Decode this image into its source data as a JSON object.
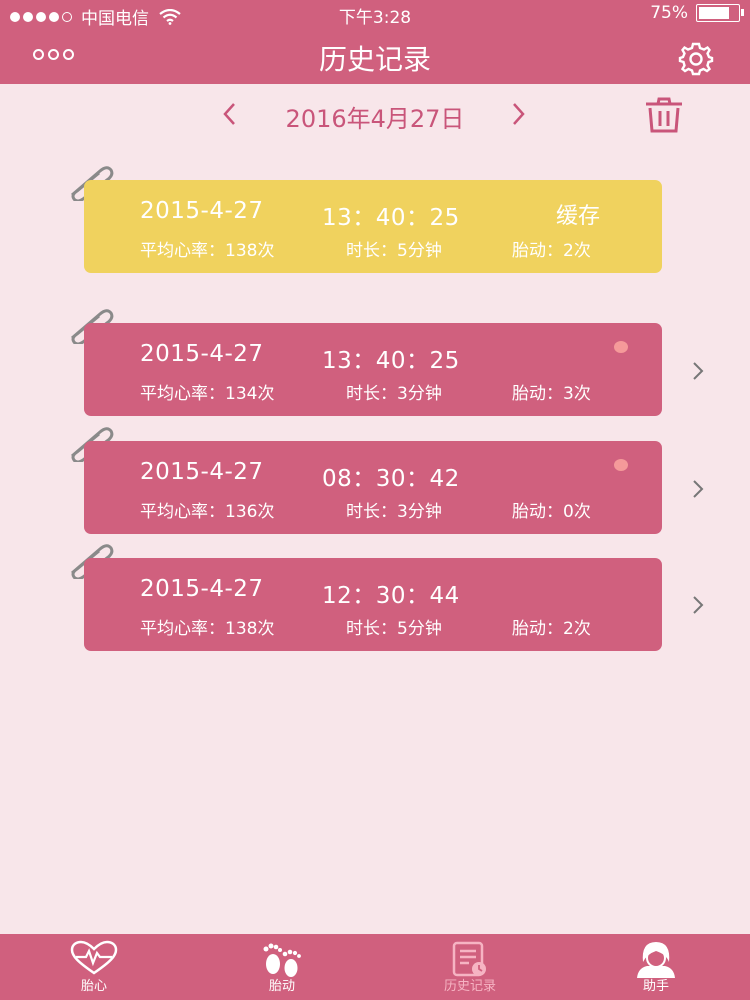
{
  "status_bar": {
    "carrier": "中国电信",
    "time": "下午3:28",
    "battery": "75%",
    "battery_level": 0.75
  },
  "header": {
    "title": "历史记录"
  },
  "date_nav": {
    "date": "2016年4月27日"
  },
  "records": [
    {
      "date": "2015-4-27",
      "time": "13：40：25",
      "badge": "缓存",
      "heart_rate": "平均心率：138次",
      "duration": "时长：5分钟",
      "movement": "胎动：2次",
      "cached": true,
      "unread": false
    },
    {
      "date": "2015-4-27",
      "time": "13：40：25",
      "badge": "",
      "heart_rate": "平均心率：134次",
      "duration": "时长：3分钟",
      "movement": "胎动：3次",
      "cached": false,
      "unread": true
    },
    {
      "date": "2015-4-27",
      "time": "08：30：42",
      "badge": "",
      "heart_rate": "平均心率：136次",
      "duration": "时长：3分钟",
      "movement": "胎动：0次",
      "cached": false,
      "unread": true
    },
    {
      "date": "2015-4-27",
      "time": "12：30：44",
      "badge": "",
      "heart_rate": "平均心率：138次",
      "duration": "时长：5分钟",
      "movement": "胎动：2次",
      "cached": false,
      "unread": false
    }
  ],
  "tabs": [
    {
      "label": "胎心",
      "icon": "heart-pulse-icon"
    },
    {
      "label": "胎动",
      "icon": "footprints-icon"
    },
    {
      "label": "历史记录",
      "icon": "history-doc-icon",
      "active": true
    },
    {
      "label": "助手",
      "icon": "assistant-avatar-icon"
    }
  ],
  "colors": {
    "primary": "#d0607e",
    "cached": "#f0d25e",
    "background": "#f8e6ea",
    "unread_dot": "#f59a9a"
  }
}
